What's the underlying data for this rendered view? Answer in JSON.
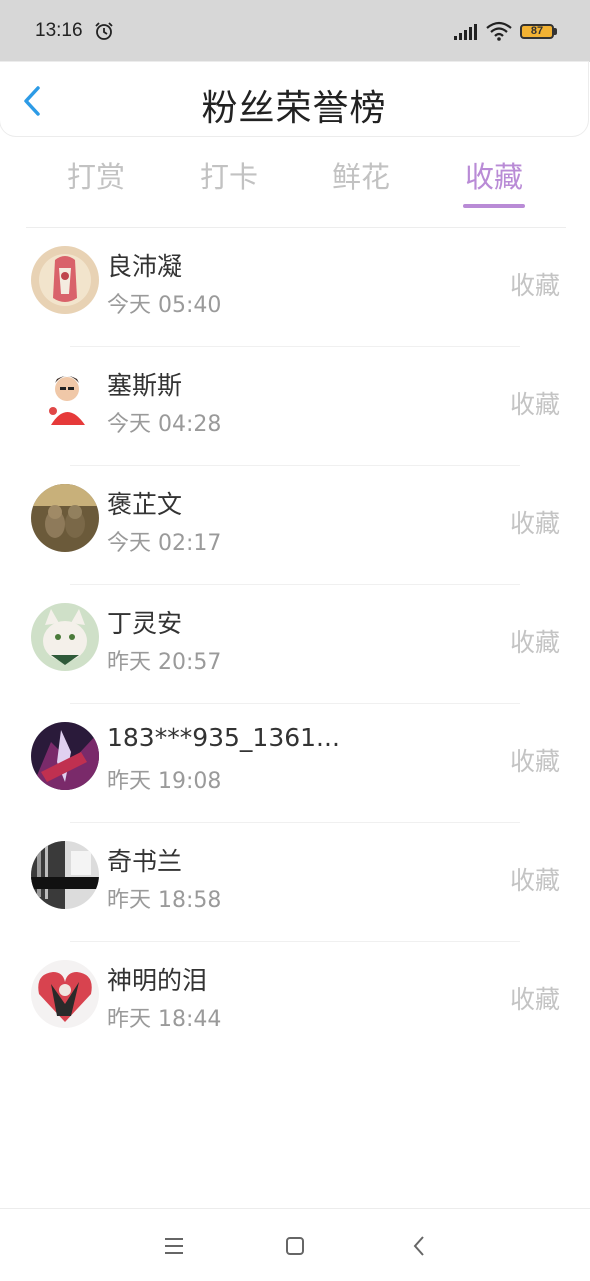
{
  "status_bar": {
    "time": "13:16",
    "battery": "87"
  },
  "header": {
    "title": "粉丝荣誉榜"
  },
  "tabs": [
    {
      "label": "打赏",
      "active": false
    },
    {
      "label": "打卡",
      "active": false
    },
    {
      "label": "鲜花",
      "active": false
    },
    {
      "label": "收藏",
      "active": true
    }
  ],
  "list": [
    {
      "name": "良沛凝",
      "time": "今天 05:40",
      "action": "收藏"
    },
    {
      "name": "塞斯斯",
      "time": "今天 04:28",
      "action": "收藏"
    },
    {
      "name": "褒芷文",
      "time": "今天 02:17",
      "action": "收藏"
    },
    {
      "name": "丁灵安",
      "time": "昨天 20:57",
      "action": "收藏"
    },
    {
      "name": "183***935_1361...",
      "time": "昨天 19:08",
      "action": "收藏"
    },
    {
      "name": "奇书兰",
      "time": "昨天 18:58",
      "action": "收藏"
    },
    {
      "name": "神明的泪",
      "time": "昨天 18:44",
      "action": "收藏"
    }
  ],
  "colors": {
    "accent": "#b98bd6",
    "back_arrow": "#2d9be6",
    "status_bar_bg": "#d7d7d7"
  }
}
